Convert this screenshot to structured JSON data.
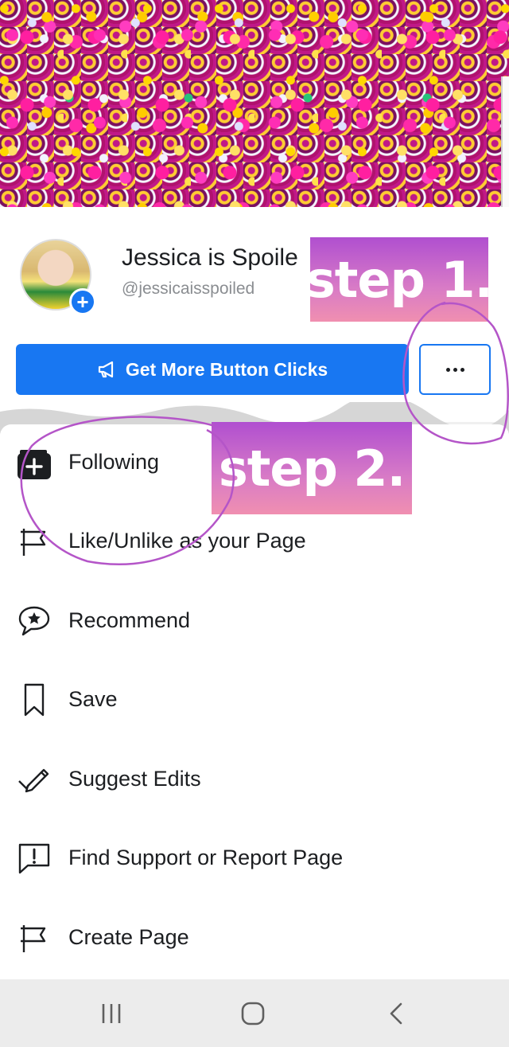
{
  "page": {
    "name": "Jessica is Spoile",
    "handle": "@jessicaisspoiled"
  },
  "actions": {
    "cta_label": "Get More Button Clicks",
    "more_icon": "more-dots-icon"
  },
  "annotations": {
    "step1": "step 1.",
    "step2": "step 2."
  },
  "menu": {
    "items": [
      {
        "label": "Following",
        "icon": "following-add-icon"
      },
      {
        "label": "Like/Unlike as your Page",
        "icon": "flag-icon"
      },
      {
        "label": "Recommend",
        "icon": "recommend-star-icon"
      },
      {
        "label": "Save",
        "icon": "bookmark-icon"
      },
      {
        "label": "Suggest Edits",
        "icon": "pencil-check-icon"
      },
      {
        "label": "Find Support or Report Page",
        "icon": "report-icon"
      },
      {
        "label": "Create Page",
        "icon": "flag-icon"
      }
    ]
  },
  "colors": {
    "brand": "#1877f2",
    "annotation_purple": "#b04fd0",
    "annotation_circle": "#b455c8"
  },
  "navigation": {
    "recent_icon": "recent-apps-icon",
    "home_icon": "home-icon",
    "back_icon": "back-icon"
  }
}
